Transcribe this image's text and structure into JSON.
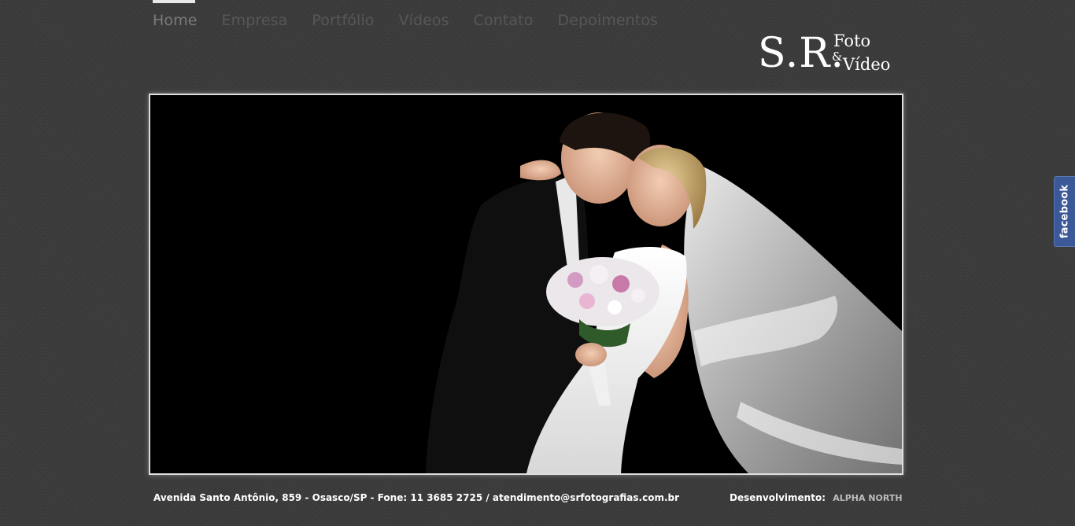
{
  "nav": {
    "items": [
      "Home",
      "Empresa",
      "Portfólio",
      "Vídeos",
      "Contato",
      "Depoimentos"
    ],
    "active": "Home"
  },
  "logo": {
    "initials": "S.R.",
    "line1": "Foto",
    "ampersand": "&",
    "line2": "Vídeo"
  },
  "hero": {
    "image": "wedding-couple-photo"
  },
  "footer": {
    "address": "Avenida Santo Antônio, 859 - Osasco/SP - Fone: 11 3685 2725 / atendimento@srfotografias.com.br",
    "dev_label": "Desenvolvimento:",
    "dev_link": "ALPHA NORTH"
  },
  "social": {
    "facebook_label": "facebook"
  },
  "colors": {
    "background": "#3b3b3b",
    "nav_text": "#575757",
    "nav_active_bar": "#e8e8e8",
    "frame_border": "#dddddd",
    "facebook_blue": "#3b5998"
  }
}
